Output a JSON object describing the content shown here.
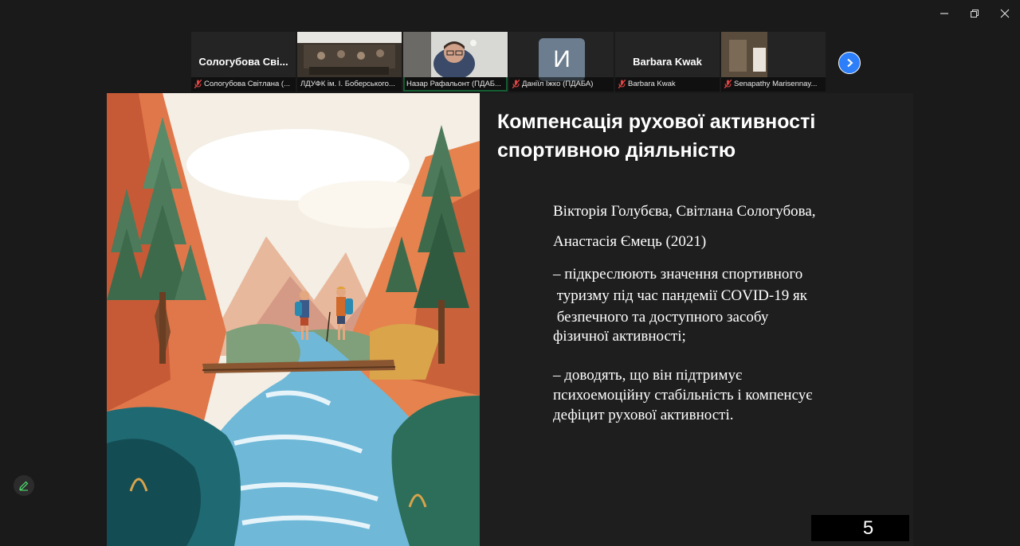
{
  "window": {
    "minimize": "minimize",
    "restore": "restore",
    "close": "close"
  },
  "participants": [
    {
      "display_name": "Сологубова Сві...",
      "label": "Сологубова Світлана (...",
      "muted": true,
      "kind": "name"
    },
    {
      "display_name": "",
      "label": "ЛДУФК ім. І. Боберського...",
      "muted": false,
      "kind": "video"
    },
    {
      "display_name": "",
      "label": "Назар Рафальонт  (ПДАБ...",
      "muted": false,
      "kind": "video",
      "active": true
    },
    {
      "display_name": "И",
      "label": "Даніїл Іжко (ПДАБА)",
      "muted": true,
      "kind": "avatar"
    },
    {
      "display_name": "Barbara Kwak",
      "label": "Barbara Kwak",
      "muted": true,
      "kind": "name"
    },
    {
      "display_name": "",
      "label": "Senapathy Marisennay...",
      "muted": true,
      "kind": "video"
    }
  ],
  "slide": {
    "title": "Компенсація рухової активності\nспортивною діяльністю",
    "lines": [
      "Вікторія Голубєва, Світлана Сологубова,",
      "Анастасія Ємець (2021)",
      "– підкреслюють значення спортивного",
      " туризму під час пандемії COVID-19 як",
      " безпечного та доступного засобу",
      "фізичної активності;",
      "– доводять, що він підтримує",
      "психоемоційну стабільність і компенсує",
      "дефіцит рухової активності."
    ],
    "page_number": "5"
  },
  "colors": {
    "accent": "#2d7ff9",
    "active_border": "#2ecc71",
    "mute": "#e04444"
  }
}
